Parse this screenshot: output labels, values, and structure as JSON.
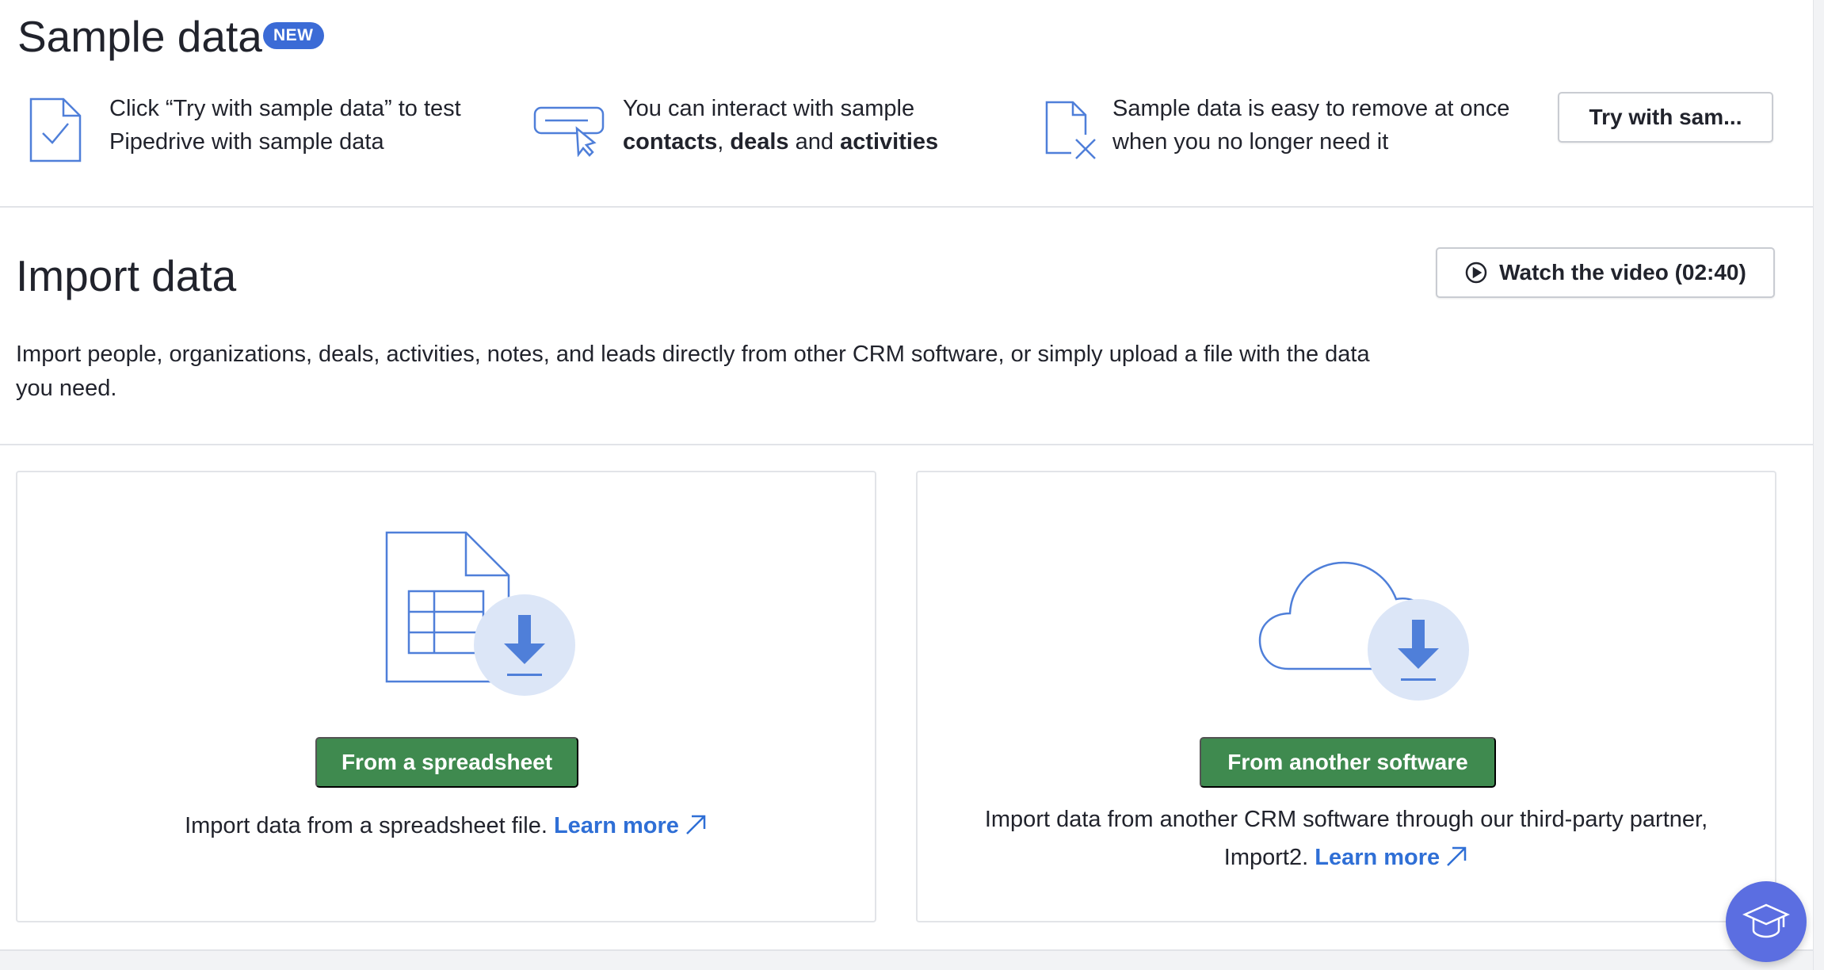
{
  "sample": {
    "title": "Sample data",
    "badge": "NEW",
    "features": [
      {
        "icon": "document-check-icon",
        "line1": "Click “Try with sample data” to test",
        "line2": "Pipedrive with sample data"
      },
      {
        "icon": "cursor-click-icon",
        "line1": "You can interact with sample",
        "bold1": "contacts",
        "sep1": ", ",
        "bold2": "deals",
        "sep2": " and ",
        "bold3": "activities"
      },
      {
        "icon": "document-remove-icon",
        "line1": "Sample data is easy to remove at once",
        "line2": "when you no longer need it"
      }
    ],
    "try_button": "Try with sam..."
  },
  "import": {
    "title": "Import data",
    "video_button": "Watch the video (02:40)",
    "description": "Import people, organizations, deals, activities, notes, and leads directly from other CRM software, or simply upload a file with the data you need.",
    "cards": [
      {
        "icon": "spreadsheet-download-icon",
        "button": "From a spreadsheet",
        "text": "Import data from a spreadsheet file.",
        "link": "Learn more"
      },
      {
        "icon": "cloud-download-icon",
        "button": "From another software",
        "text": "Import data from another CRM software through our third-party partner, Import2.",
        "link": "Learn more"
      }
    ]
  },
  "colors": {
    "accent_blue": "#3b6bd6",
    "link_blue": "#2f6fd6",
    "button_green": "#3f8a4f",
    "icon_blue": "#4f7fd9",
    "icon_circle": "#dce6f7",
    "help_button": "#5b6ee1"
  },
  "help_button_icon": "graduation-cap-icon"
}
